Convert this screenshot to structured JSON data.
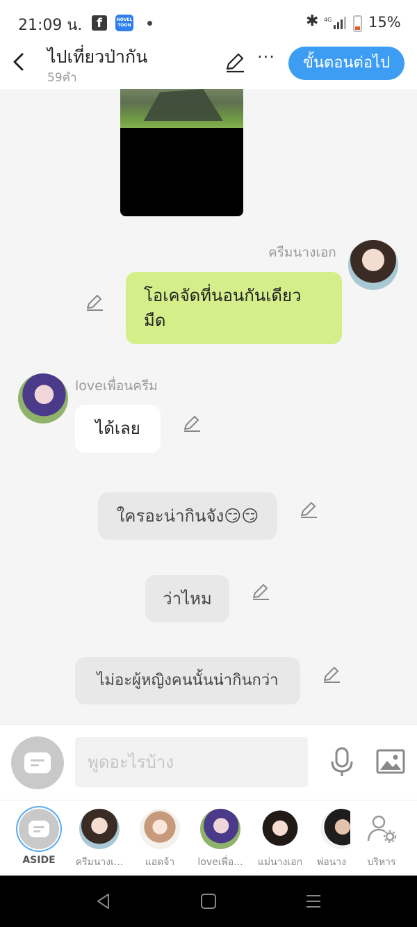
{
  "status_bar": {
    "time": "21:09 น.",
    "facebook_icon": "f",
    "noveltoon_icon": "NOVEL TOON",
    "battery": "15%"
  },
  "header": {
    "title": "ไปเที่ยวป่ากัน",
    "word_count": "59คำ",
    "more": "···",
    "next_button": "ขั้นตอนต่อไป"
  },
  "messages": [
    {
      "type": "image",
      "description_icon": "tent-photo"
    },
    {
      "type": "outgoing",
      "sender": "ครีมนางเอก",
      "text_line1": "โอเคจัดที่นอนกันเดียว",
      "text_line2": "มืด"
    },
    {
      "type": "incoming",
      "sender": "loveเพื่อนครีม",
      "text": "ได้เลย"
    },
    {
      "type": "aside",
      "text": "ใครอะน่ากินจัง😏😏"
    },
    {
      "type": "aside",
      "text": "ว่าไหม"
    },
    {
      "type": "aside",
      "text": "ไม่อะผู้หญิงคนนั้นน่ากินกว่า"
    }
  ],
  "input": {
    "placeholder": "พูดอะไรบ้าง"
  },
  "characters": [
    {
      "label": "ASIDE"
    },
    {
      "label": "ครีมนางเ..."
    },
    {
      "label": "แอดจ้า"
    },
    {
      "label": "loveเพื่อ..."
    },
    {
      "label": "แม่นางเอก"
    },
    {
      "label": "พ่อนาง"
    },
    {
      "label": "บริหาร"
    }
  ],
  "colors": {
    "accent": "#3d9df2",
    "outgoing_bubble": "#d4ef8a",
    "aside_bubble": "#e8e8e8",
    "background": "#f5f5f5"
  }
}
